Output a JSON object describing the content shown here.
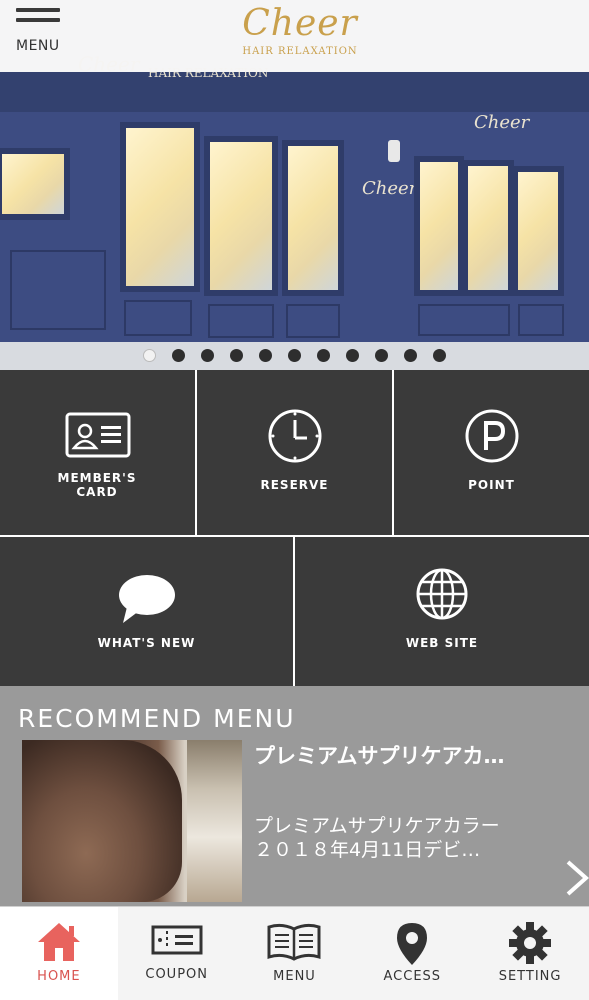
{
  "header": {
    "menu_label": "MENU",
    "logo_main": "Cheer",
    "logo_sub": "HAIR RELAXATION"
  },
  "hero": {
    "slide_count": 11,
    "active_slide": 0,
    "sign_main": "Cheer",
    "sign_sub": "HAIR RELAXATION"
  },
  "grid": {
    "members_card": "MEMBER'S CARD",
    "reserve": "RESERVE",
    "point": "POINT",
    "whats_new": "WHAT'S NEW",
    "web_site": "WEB SITE"
  },
  "recommend": {
    "title": "RECOMMEND MENU",
    "item_name": "プレミアムサプリケアカ…",
    "item_desc_line1": "プレミアムサプリケアカラー",
    "item_desc_line2": "２０１８年4月11日デビ…"
  },
  "tabbar": {
    "home": "HOME",
    "coupon": "COUPON",
    "menu": "MENU",
    "access": "ACCESS",
    "setting": "SETTING"
  },
  "colors": {
    "tile_bg": "#3a3a3a",
    "recommend_bg": "#9a9a9a",
    "active_tab": "#d9534f",
    "logo": "#c9a04c"
  }
}
